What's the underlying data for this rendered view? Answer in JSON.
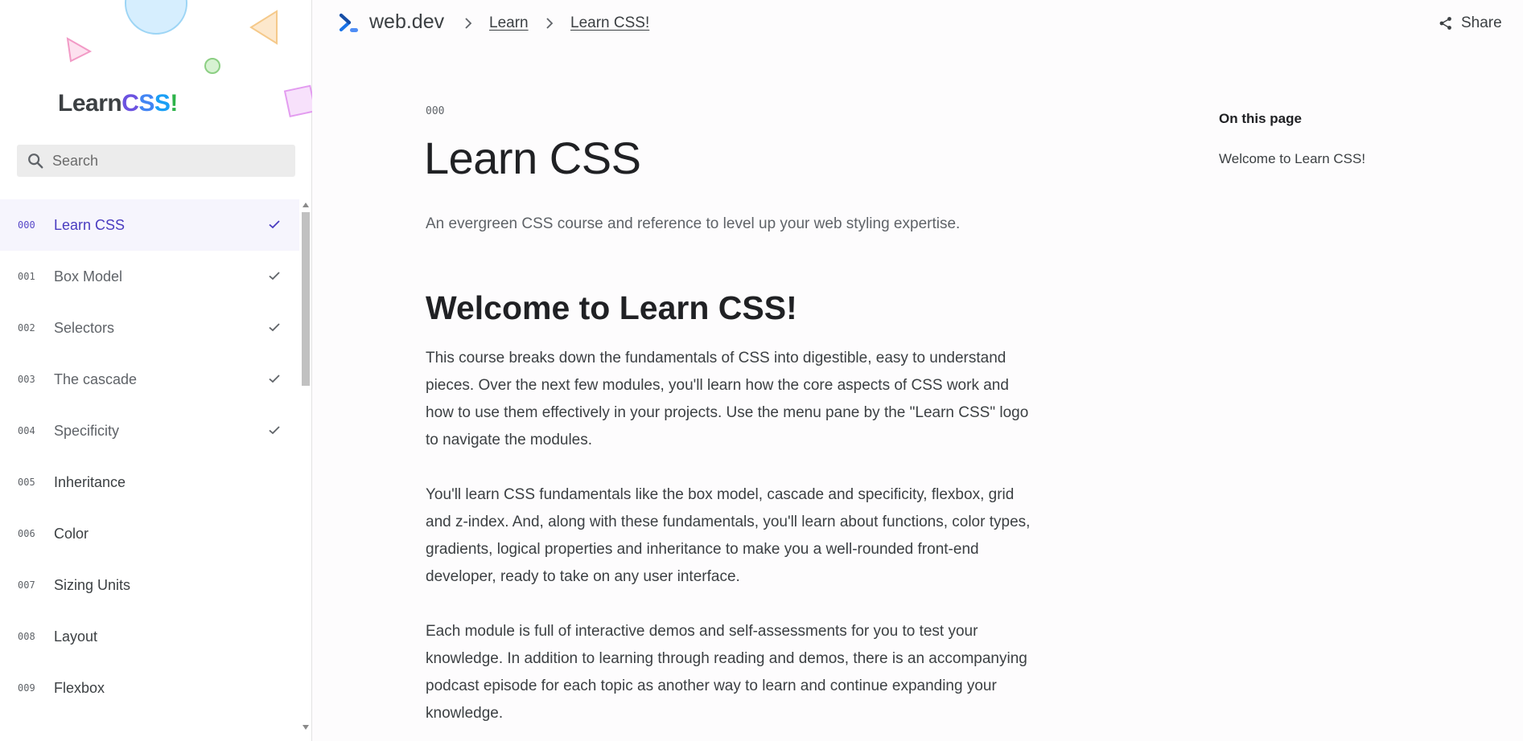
{
  "sidebar": {
    "logo": {
      "learn": "Learn",
      "c": "C",
      "s1": "S",
      "s2": "S",
      "bang": "!"
    },
    "search": {
      "placeholder": "Search",
      "icon": "search-icon"
    },
    "items": [
      {
        "num": "000",
        "label": "Learn CSS",
        "completed": true,
        "active": true
      },
      {
        "num": "001",
        "label": "Box Model",
        "completed": true
      },
      {
        "num": "002",
        "label": "Selectors",
        "completed": true
      },
      {
        "num": "003",
        "label": "The cascade",
        "completed": true
      },
      {
        "num": "004",
        "label": "Specificity",
        "completed": true
      },
      {
        "num": "005",
        "label": "Inheritance",
        "completed": false
      },
      {
        "num": "006",
        "label": "Color",
        "completed": false
      },
      {
        "num": "007",
        "label": "Sizing Units",
        "completed": false
      },
      {
        "num": "008",
        "label": "Layout",
        "completed": false
      },
      {
        "num": "009",
        "label": "Flexbox",
        "completed": false
      }
    ]
  },
  "header": {
    "brand": "web.dev",
    "breadcrumbs": [
      "Learn",
      "Learn CSS!"
    ],
    "share_label": "Share"
  },
  "main": {
    "page_num": "000",
    "title": "Learn CSS",
    "lede": "An evergreen CSS course and reference to level up your web styling expertise.",
    "section_title": "Welcome to Learn CSS!",
    "paragraphs": [
      "This course breaks down the fundamentals of CSS into digestible, easy to understand pieces. Over the next few modules, you'll learn how the core aspects of CSS work and how to use them effectively in your projects. Use the menu pane by the \"Learn CSS\" logo to navigate the modules.",
      "You'll learn CSS fundamentals like the box model, cascade and specificity, flexbox, grid and z-index. And, along with these fundamentals, you'll learn about functions, color types, gradients, logical properties and inheritance to make you a well-rounded front-end developer, ready to take on any user interface.",
      "Each module is full of interactive demos and self-assessments for you to test your knowledge. In addition to learning through reading and demos, there is an accompanying podcast episode for each topic as another way to learn and continue expanding your knowledge."
    ]
  },
  "toc": {
    "title": "On this page",
    "links": [
      "Welcome to Learn CSS!"
    ]
  },
  "colors": {
    "accent": "#4a3cc0",
    "active_bg": "#f6f5fd",
    "brand_blue": "#1a73e8"
  }
}
